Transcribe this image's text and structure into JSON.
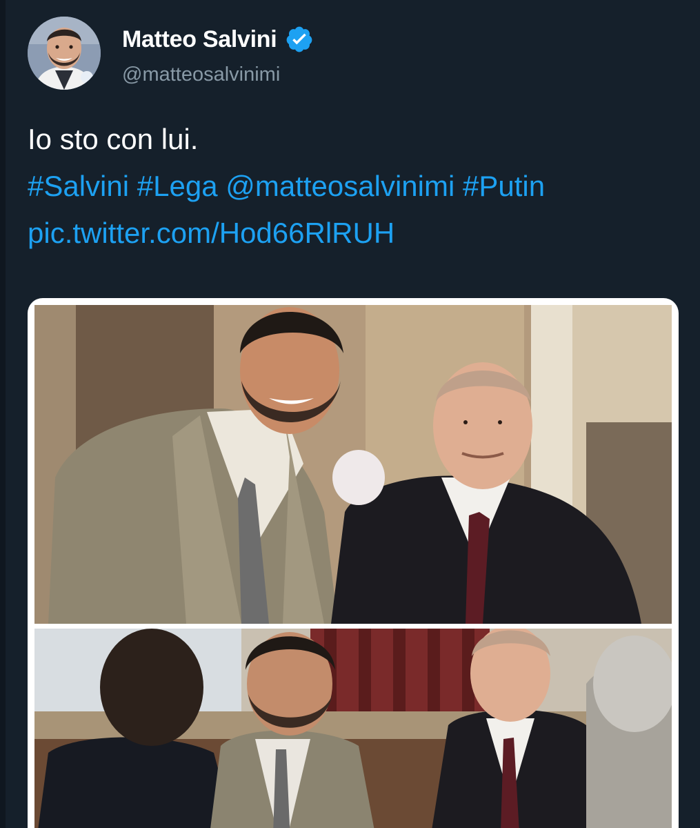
{
  "tweet": {
    "author": {
      "display_name": "Matteo Salvini",
      "handle": "@matteosalvinimi",
      "verified_icon": "verified-badge-icon",
      "avatar_icon": "profile-avatar"
    },
    "text": {
      "line1": "Io sto con lui.",
      "tags": [
        {
          "text": "#Salvini"
        },
        {
          "text": "#Lega"
        },
        {
          "text": "@matteosalvinimi"
        },
        {
          "text": "#Putin"
        }
      ],
      "link": "pic.twitter.com/Hod66RlRUH"
    },
    "media": {
      "photos": [
        {
          "name": "photo-two-men-standing"
        },
        {
          "name": "photo-men-at-table"
        }
      ]
    },
    "colors": {
      "background": "#15202b",
      "link": "#1da1f2",
      "verified": "#1da1f2",
      "handle": "#8899a6"
    }
  }
}
